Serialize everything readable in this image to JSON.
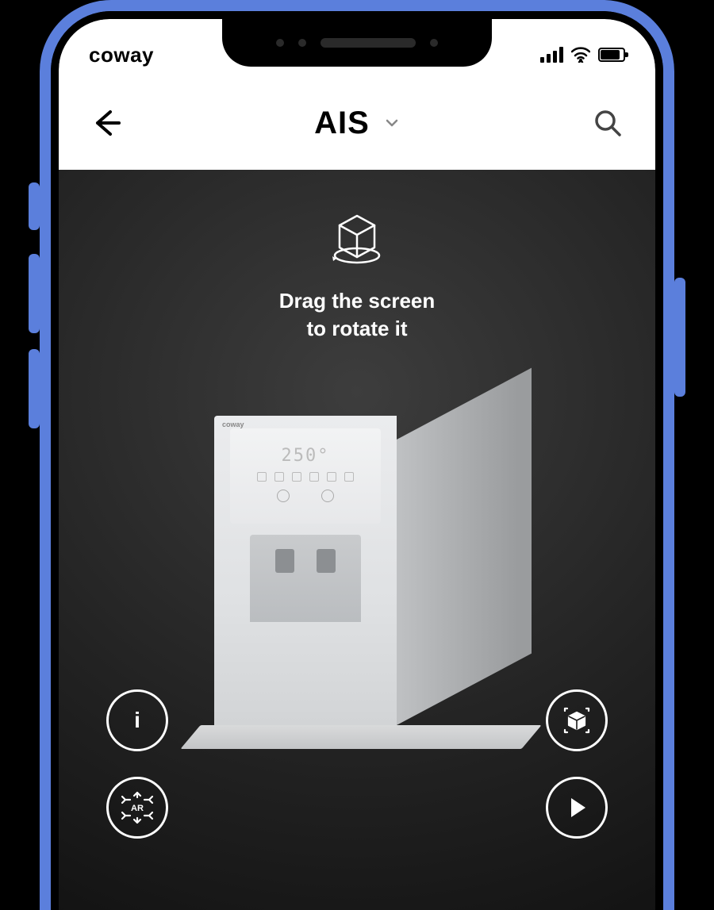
{
  "status_bar": {
    "brand": "coway"
  },
  "header": {
    "title": "AIS"
  },
  "viewer": {
    "hint_line1": "Drag the screen",
    "hint_line2": "to rotate it",
    "product": {
      "brand": "coway",
      "display_readout": "250°"
    },
    "fabs": {
      "info_label": "i",
      "ar_label": "AR"
    }
  }
}
